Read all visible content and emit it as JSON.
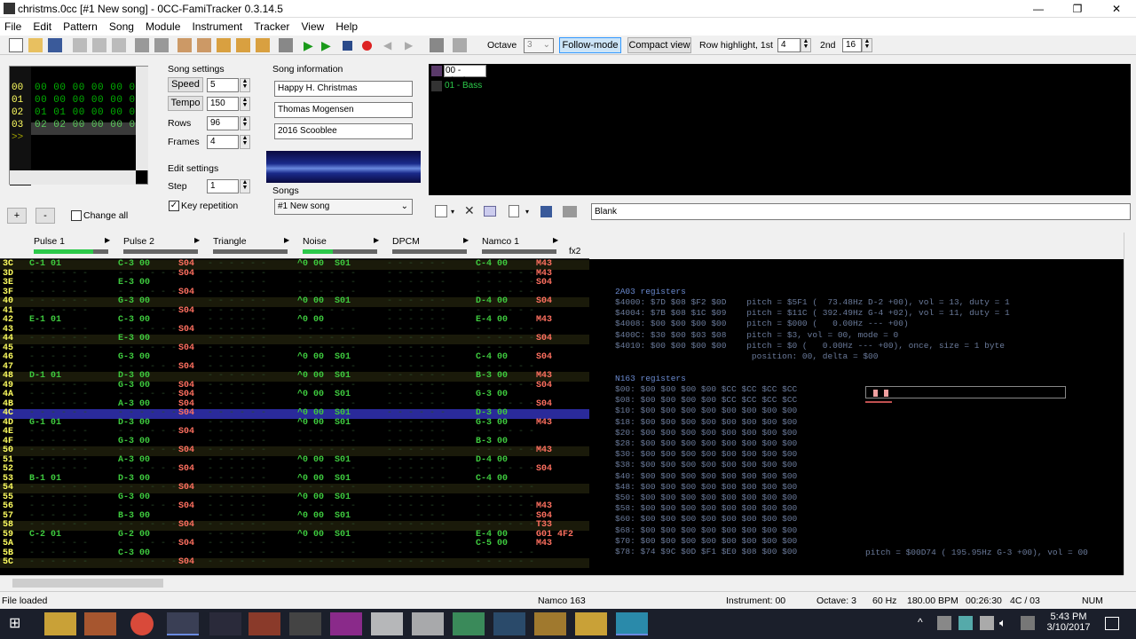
{
  "window": {
    "title": "christms.0cc [#1 New song] - 0CC-FamiTracker 0.3.14.5",
    "controls": [
      "—",
      "❐",
      "✕"
    ]
  },
  "menu": [
    "File",
    "Edit",
    "Pattern",
    "Song",
    "Module",
    "Instrument",
    "Tracker",
    "View",
    "Help"
  ],
  "toolbar": {
    "octave_label": "Octave",
    "octave_value": "3",
    "follow_mode": "Follow-mode",
    "compact_view": "Compact view",
    "row_highlight_label": "Row highlight, 1st",
    "row_highlight_1st": "4",
    "second_label": "2nd",
    "row_highlight_2nd": "16"
  },
  "frames": {
    "rows": [
      {
        "num": "00",
        "data": "00 00 00 00 00 00"
      },
      {
        "num": "01",
        "data": "00 00 00 00 00 00"
      },
      {
        "num": "02",
        "data": "01 01 00 00 00 01"
      },
      {
        "num": "03",
        "data": "02 02 00 00 00 02"
      },
      {
        "num": ">>",
        "data": ""
      }
    ],
    "add": "+",
    "remove": "-",
    "change_all": "Change all"
  },
  "song_settings": {
    "header": "Song settings",
    "speed_label": "Speed",
    "speed": "5",
    "tempo_label": "Tempo",
    "tempo": "150",
    "rows_label": "Rows",
    "rows": "96",
    "frames_label": "Frames",
    "frames": "4"
  },
  "edit_settings": {
    "header": "Edit settings",
    "step_label": "Step",
    "step": "1",
    "key_repetition": "Key repetition"
  },
  "song_info": {
    "header": "Song information",
    "title": "Happy H. Christmas",
    "author": "Thomas Mogensen",
    "copyright": "2016 Scooblee",
    "songs_label": "Songs",
    "song_selected": "#1 New song"
  },
  "instruments": {
    "items": [
      {
        "label": "00 - Blank",
        "selected": true
      },
      {
        "label": "01 - Bass",
        "selected": false
      }
    ],
    "name_field": "Blank"
  },
  "channels": [
    {
      "name": "Pulse 1",
      "level": 0.8
    },
    {
      "name": "Pulse 2",
      "level": 0.0
    },
    {
      "name": "Triangle",
      "level": 0.0
    },
    {
      "name": "Noise",
      "level": 0.4
    },
    {
      "name": "DPCM",
      "level": 0.0
    },
    {
      "name": "Namco 1",
      "level": 0.0
    }
  ],
  "channel_extra": "fx2",
  "pattern_rows": [
    {
      "n": "3C",
      "c": [
        "C-1 01",
        "C-3 00",
        "",
        "^0 00  S01",
        "",
        "C-4 00"
      ],
      "e": [
        "",
        "S04",
        "",
        "",
        "",
        "M43"
      ]
    },
    {
      "n": "3D",
      "c": [
        "",
        "",
        "",
        "",
        "",
        ""
      ],
      "e": [
        "",
        "S04",
        "",
        "",
        "",
        "M43"
      ]
    },
    {
      "n": "3E",
      "c": [
        "",
        "E-3 00",
        "",
        "",
        "",
        ""
      ],
      "e": [
        "",
        "",
        "",
        "",
        "",
        "S04"
      ]
    },
    {
      "n": "3F",
      "c": [
        "",
        "",
        "",
        "",
        "",
        ""
      ],
      "e": [
        "",
        "S04",
        "",
        "",
        "",
        ""
      ]
    },
    {
      "n": "40",
      "c": [
        "",
        "G-3 00",
        "",
        "^0 00  S01",
        "",
        "D-4 00"
      ],
      "e": [
        "",
        "",
        "",
        "",
        "",
        "S04"
      ]
    },
    {
      "n": "41",
      "c": [
        "",
        "",
        "",
        "",
        "",
        ""
      ],
      "e": [
        "",
        "S04",
        "",
        "",
        "",
        ""
      ]
    },
    {
      "n": "42",
      "c": [
        "E-1 01",
        "C-3 00",
        "",
        "^0 00",
        "",
        "E-4 00"
      ],
      "e": [
        "",
        "",
        "",
        "",
        "",
        "M43"
      ]
    },
    {
      "n": "43",
      "c": [
        "",
        "",
        "",
        "",
        "",
        ""
      ],
      "e": [
        "",
        "S04",
        "",
        "",
        "",
        ""
      ]
    },
    {
      "n": "44",
      "c": [
        "",
        "E-3 00",
        "",
        "",
        "",
        ""
      ],
      "e": [
        "",
        "",
        "",
        "",
        "",
        "S04"
      ]
    },
    {
      "n": "45",
      "c": [
        "",
        "",
        "",
        "",
        "",
        ""
      ],
      "e": [
        "",
        "S04",
        "",
        "",
        "",
        ""
      ]
    },
    {
      "n": "46",
      "c": [
        "",
        "G-3 00",
        "",
        "^0 00  S01",
        "",
        "C-4 00"
      ],
      "e": [
        "",
        "",
        "",
        "",
        "",
        "S04"
      ]
    },
    {
      "n": "47",
      "c": [
        "",
        "",
        "",
        "",
        "",
        ""
      ],
      "e": [
        "",
        "S04",
        "",
        "",
        "",
        ""
      ]
    },
    {
      "n": "48",
      "c": [
        "D-1 01",
        "D-3 00",
        "",
        "^0 00  S01",
        "",
        "B-3 00"
      ],
      "e": [
        "",
        "",
        "",
        "",
        "",
        "M43"
      ]
    },
    {
      "n": "49",
      "c": [
        "",
        "G-3 00",
        "",
        "",
        "",
        ""
      ],
      "e": [
        "",
        "S04",
        "",
        "",
        "",
        "S04"
      ]
    },
    {
      "n": "4A",
      "c": [
        "",
        "",
        "",
        "^0 00  S01",
        "",
        "G-3 00"
      ],
      "e": [
        "",
        "S04",
        "",
        "",
        "",
        ""
      ]
    },
    {
      "n": "4B",
      "c": [
        "",
        "A-3 00",
        "",
        "",
        "",
        ""
      ],
      "e": [
        "",
        "S04",
        "",
        "",
        "",
        "S04"
      ]
    },
    {
      "n": "4C",
      "c": [
        "",
        "",
        "",
        "^0 00  S01",
        "",
        "D-3 00"
      ],
      "e": [
        "",
        "S04",
        "",
        "",
        "",
        ""
      ]
    },
    {
      "n": "4D",
      "c": [
        "G-1 01",
        "D-3 00",
        "",
        "^0 00  S01",
        "",
        "G-3 00"
      ],
      "e": [
        "",
        "",
        "",
        "",
        "",
        "M43"
      ]
    },
    {
      "n": "4E",
      "c": [
        "",
        "",
        "",
        "",
        "",
        ""
      ],
      "e": [
        "",
        "S04",
        "",
        "",
        "",
        ""
      ]
    },
    {
      "n": "4F",
      "c": [
        "",
        "G-3 00",
        "",
        "",
        "",
        "B-3 00"
      ],
      "e": [
        "",
        "",
        "",
        "",
        "",
        ""
      ]
    },
    {
      "n": "50",
      "c": [
        "",
        "",
        "",
        "",
        "",
        ""
      ],
      "e": [
        "",
        "S04",
        "",
        "",
        "",
        "M43"
      ]
    },
    {
      "n": "51",
      "c": [
        "",
        "A-3 00",
        "",
        "^0 00  S01",
        "",
        "D-4 00"
      ],
      "e": [
        "",
        "",
        "",
        "",
        "",
        ""
      ]
    },
    {
      "n": "52",
      "c": [
        "",
        "",
        "",
        "",
        "",
        ""
      ],
      "e": [
        "",
        "S04",
        "",
        "",
        "",
        "S04"
      ]
    },
    {
      "n": "53",
      "c": [
        "B-1 01",
        "D-3 00",
        "",
        "^0 00  S01",
        "",
        "C-4 00"
      ],
      "e": [
        "",
        "",
        "",
        "",
        "",
        ""
      ]
    },
    {
      "n": "54",
      "c": [
        "",
        "",
        "",
        "",
        "",
        ""
      ],
      "e": [
        "",
        "S04",
        "",
        "",
        "",
        ""
      ]
    },
    {
      "n": "55",
      "c": [
        "",
        "G-3 00",
        "",
        "^0 00  S01",
        "",
        ""
      ],
      "e": [
        "",
        "",
        "",
        "",
        "",
        ""
      ]
    },
    {
      "n": "56",
      "c": [
        "",
        "",
        "",
        "",
        "",
        ""
      ],
      "e": [
        "",
        "S04",
        "",
        "",
        "",
        "M43"
      ]
    },
    {
      "n": "57",
      "c": [
        "",
        "B-3 00",
        "",
        "^0 00  S01",
        "",
        ""
      ],
      "e": [
        "",
        "",
        "",
        "",
        "",
        "S04"
      ]
    },
    {
      "n": "58",
      "c": [
        "",
        "",
        "",
        "",
        "",
        ""
      ],
      "e": [
        "",
        "S04",
        "",
        "",
        "",
        "T33"
      ]
    },
    {
      "n": "59",
      "c": [
        "C-2 01",
        "G-2 00",
        "",
        "^0 00  S01",
        "",
        "E-4 00"
      ],
      "e": [
        "",
        "",
        "",
        "",
        "",
        "G01 4F2"
      ]
    },
    {
      "n": "5A",
      "c": [
        "",
        "",
        "",
        "",
        "",
        "C-5 00"
      ],
      "e": [
        "",
        "S04",
        "",
        "",
        "",
        "M43"
      ]
    },
    {
      "n": "5B",
      "c": [
        "",
        "C-3 00",
        "",
        "",
        "",
        ""
      ],
      "e": [
        "",
        "",
        "",
        "",
        "",
        ""
      ]
    },
    {
      "n": "5C",
      "c": [
        "",
        "",
        "",
        "",
        "",
        ""
      ],
      "e": [
        "",
        "S04",
        "",
        "",
        "",
        ""
      ]
    }
  ],
  "registers": {
    "apu_header": "2A03 registers",
    "apu": [
      "$4000: $7D $08 $F2 $0D    pitch = $5F1 (  73.48Hz D-2 +00), vol = 13, duty = 1",
      "$4004: $7B $08 $1C $09    pitch = $11C ( 392.49Hz G-4 +02), vol = 11, duty = 1",
      "$4008: $00 $00 $00 $00    pitch = $000 (   0.00Hz --- +00)",
      "$400C: $30 $00 $03 $08    pitch = $3, vol = 00, mode = 0",
      "$4010: $00 $00 $00 $00    pitch = $0 (   0.00Hz --- +00), once, size = 1 byte",
      "                           position: 00, delta = $00"
    ],
    "n163_header": "N163 registers",
    "n163": [
      "$00: $00 $00 $00 $00 $CC $CC $CC $CC",
      "$08: $00 $00 $00 $00 $CC $CC $CC $CC",
      "$10: $00 $00 $00 $00 $00 $00 $00 $00",
      "$18: $00 $00 $00 $00 $00 $00 $00 $00",
      "$20: $00 $00 $00 $00 $00 $00 $00 $00",
      "$28: $00 $00 $00 $00 $00 $00 $00 $00",
      "$30: $00 $00 $00 $00 $00 $00 $00 $00",
      "$38: $00 $00 $00 $00 $00 $00 $00 $00",
      "$40: $00 $00 $00 $00 $00 $00 $00 $00",
      "$48: $00 $00 $00 $00 $00 $00 $00 $00",
      "$50: $00 $00 $00 $00 $00 $00 $00 $00",
      "$58: $00 $00 $00 $00 $00 $00 $00 $00",
      "$60: $00 $00 $00 $00 $00 $00 $00 $00",
      "$68: $00 $00 $00 $00 $00 $00 $00 $00",
      "$70: $00 $00 $00 $00 $00 $00 $00 $00",
      "$78: $74 $9C $0D $F1 $E0 $08 $00 $00"
    ],
    "n163_pitch": "pitch = $00D74 ( 195.95Hz G-3 +00), vol = 00"
  },
  "status": {
    "left": "File loaded",
    "chip": "Namco 163",
    "instrument": "Instrument: 00",
    "octave": "Octave: 3",
    "rate": "60 Hz",
    "bpm": "180.00 BPM",
    "time": "00:26:30",
    "pos": "4C / 03",
    "num": "NUM"
  },
  "taskbar": {
    "time": "5:43 PM",
    "date": "3/10/2017"
  },
  "colors": {
    "accent_selected": "#2a2a9a",
    "note_green": "#3ec93e",
    "row_number": "#ffff60",
    "effect_red": "#ff7060"
  }
}
